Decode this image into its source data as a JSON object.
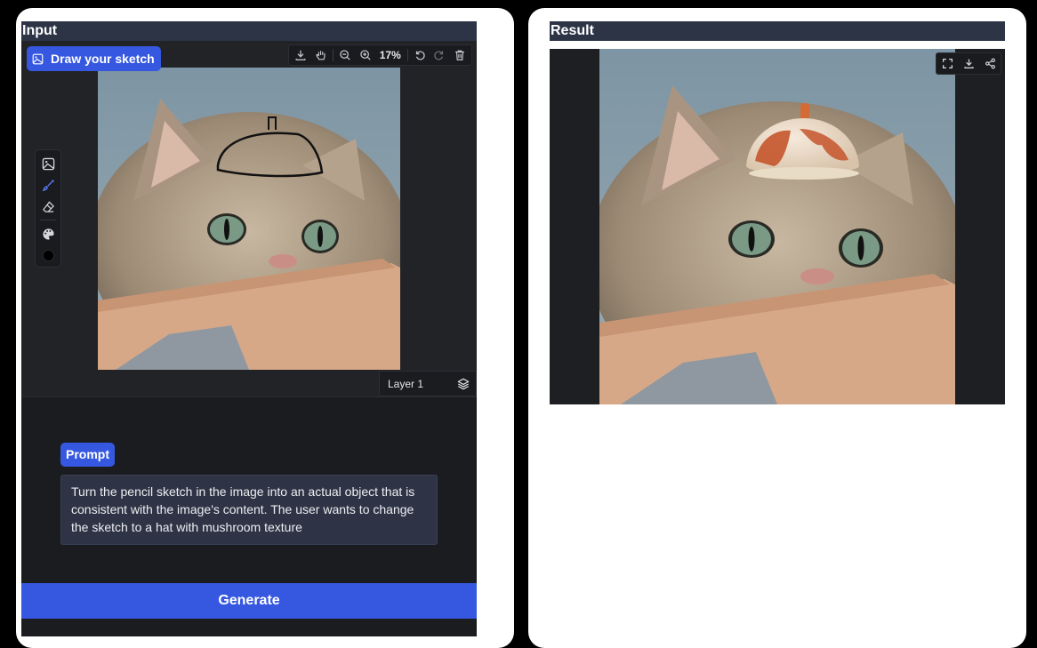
{
  "input_panel": {
    "title": "Input",
    "draw_tag_label": "Draw your sketch",
    "toolbar": {
      "zoom": "17%",
      "icons": [
        "download-icon",
        "hand-icon",
        "zoom-out-icon",
        "zoom-in-icon",
        "undo-icon",
        "redo-icon",
        "trash-icon"
      ]
    },
    "side_tools": [
      "image-icon",
      "brush-icon",
      "eraser-icon",
      "palette-icon",
      "color-dot-icon"
    ],
    "layer_label": "Layer 1",
    "prompt_label": "Prompt",
    "prompt_text": "Turn the pencil sketch in the image into an actual object that is consistent with the image's content. The user wants to change the sketch to a hat with mushroom texture",
    "generate_label": "Generate"
  },
  "result_panel": {
    "title": "Result",
    "toolbar_icons": [
      "fullscreen-icon",
      "download-icon",
      "share-icon"
    ]
  },
  "colors": {
    "accent": "#3658e0",
    "header": "#2d3446",
    "canvas_bg": "#222327",
    "prompt_bg": "#2e3445"
  }
}
